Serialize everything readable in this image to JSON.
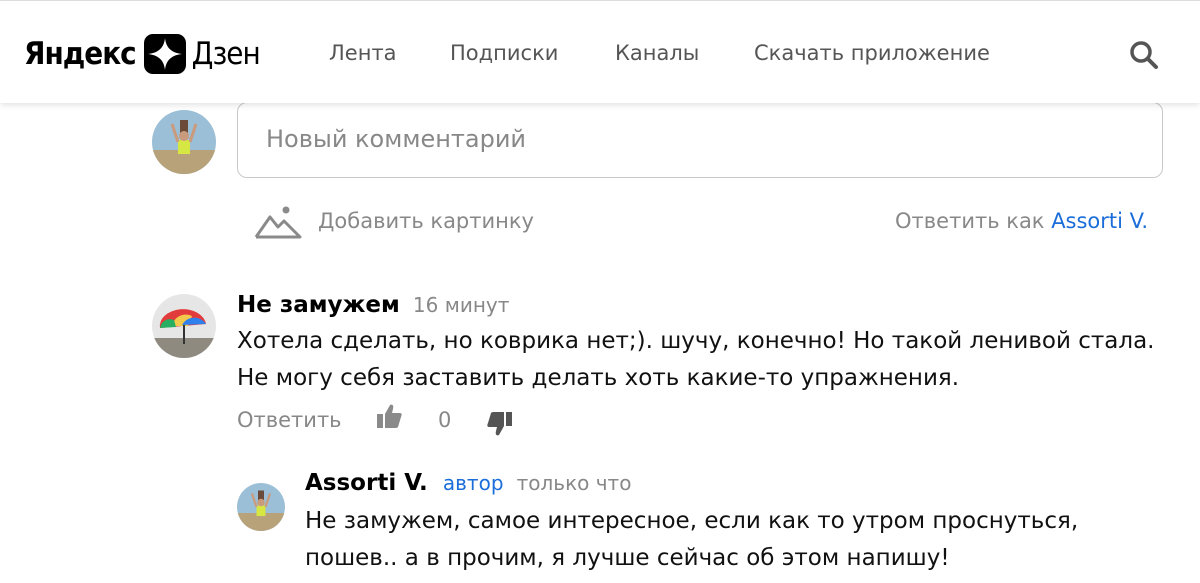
{
  "header": {
    "logo_yandex": "Яндекс",
    "logo_zen": "Дзен",
    "nav": [
      "Лента",
      "Подписки",
      "Каналы",
      "Скачать приложение"
    ],
    "search_icon": "search-icon"
  },
  "composer": {
    "placeholder": "Новый комментарий",
    "add_picture": "Добавить картинку",
    "reply_as_prefix": "Ответить как",
    "reply_as_name": "Assorti V."
  },
  "comments": [
    {
      "author": "Не замужем",
      "time": "16 минут",
      "text_line1": "Хотела сделать, но коврика нет;). шучу, конечно! Но такой ленивой стала.",
      "text_line2": "Не могу себя заставить делать хоть какие-то упражнения.",
      "reply_label": "Ответить",
      "likes": "0"
    },
    {
      "author": "Assorti V.",
      "badge": "автор",
      "time": "только что",
      "text_line1": "Не замужем, самое интересное, если как то утром проснуться,",
      "text_line2": "пошев.. а в прочим, я лучше сейчас об этом напишу!"
    }
  ],
  "colors": {
    "link": "#1b6ed9",
    "muted": "#888888",
    "border": "#c9c9c9"
  }
}
